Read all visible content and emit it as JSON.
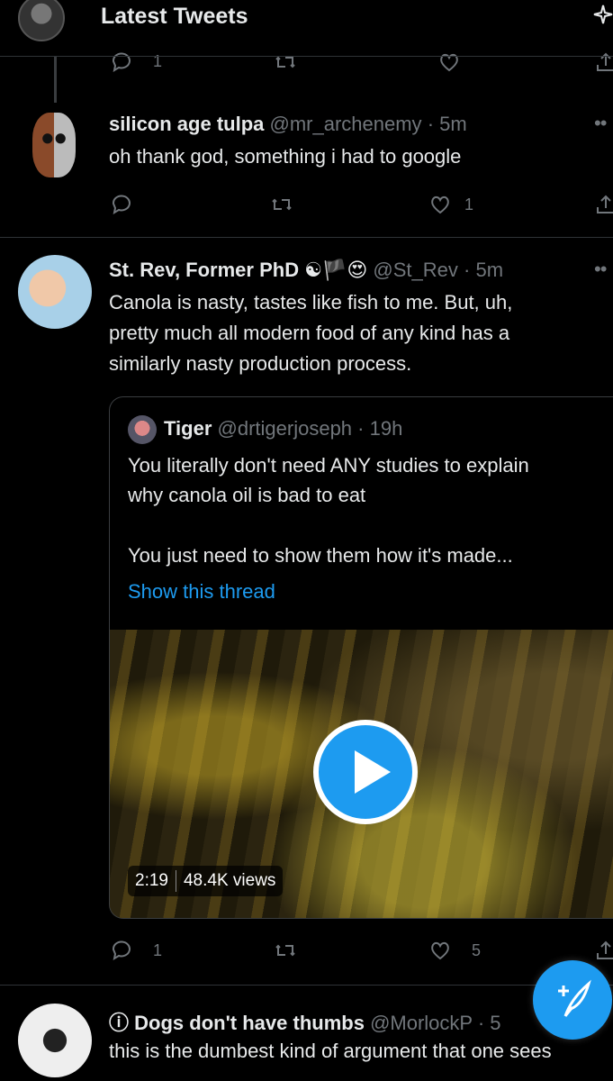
{
  "header": {
    "title": "Latest Tweets",
    "sparkle_icon": "sparkle-icon"
  },
  "top_actions": {
    "reply_count": "1"
  },
  "tweets": [
    {
      "name": "silicon age tulpa",
      "handle": "@mr_archenemy",
      "time": "· 5m",
      "text_lines": [
        "oh thank god, something i had to google"
      ],
      "reply_count": "",
      "like_count": "1"
    },
    {
      "name": "St. Rev, Former PhD",
      "name_emoji": "☯🏴😍",
      "handle": "@St_Rev",
      "time": "· 5m",
      "text_lines": [
        "Canola is nasty, tastes like fish to me. But, uh,",
        "pretty much all modern food of any kind has a",
        "similarly nasty production process."
      ],
      "reply_count": "1",
      "like_count": "5",
      "quote": {
        "name": "Tiger",
        "handle": "@drtigerjoseph",
        "time": "· 19h",
        "text_lines": [
          "You literally don't need ANY studies to explain",
          "why canola oil is bad to eat",
          "You just need to show them how it's made..."
        ],
        "show_thread": "Show this thread",
        "video_duration": "2:19",
        "video_views": "48.4K views"
      }
    },
    {
      "name_prefix": "ⓘ",
      "name": "Dogs don't have thumbs",
      "handle": "@MorlockP",
      "time": "· 5",
      "text_lines": [
        "this is the dumbest kind of argument that one sees"
      ]
    }
  ],
  "icons": {
    "reply": "reply-icon",
    "retweet": "retweet-icon",
    "like": "heart-icon",
    "share": "share-icon",
    "compose": "compose-tweet-icon"
  },
  "colors": {
    "background": "#000000",
    "accent": "#1d9bf0",
    "muted": "#71767b",
    "divider": "#2f3336"
  }
}
